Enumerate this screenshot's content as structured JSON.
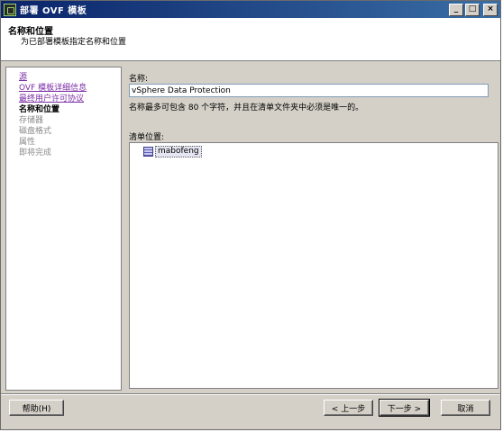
{
  "window": {
    "title": "部署 OVF 模板",
    "controls": {
      "minimize": "_",
      "maximize": "□",
      "close": "×"
    }
  },
  "header": {
    "title": "名称和位置",
    "subtitle": "为已部署模板指定名称和位置"
  },
  "nav": {
    "items": [
      {
        "label": "源",
        "state": "link"
      },
      {
        "label": "OVF 模板详细信息",
        "state": "link"
      },
      {
        "label": "最终用户许可协议",
        "state": "link"
      },
      {
        "label": "名称和位置",
        "state": "current"
      },
      {
        "label": "存储器",
        "state": "disabled"
      },
      {
        "label": "磁盘格式",
        "state": "disabled"
      },
      {
        "label": "属性",
        "state": "disabled"
      },
      {
        "label": "即将完成",
        "state": "disabled"
      }
    ]
  },
  "form": {
    "name_label": "名称:",
    "name_value": "vSphere Data Protection",
    "name_hint": "名称最多可包含 80 个字符，并且在清单文件夹中必须是唯一的。",
    "inventory_label": "清单位置:",
    "inventory_tree": [
      {
        "label": "mabofeng",
        "icon": "datacenter-icon",
        "selected": true
      }
    ]
  },
  "buttons": {
    "help": "帮助(H)",
    "back": "< 上一步",
    "next": "下一步 >",
    "cancel": "取消"
  }
}
